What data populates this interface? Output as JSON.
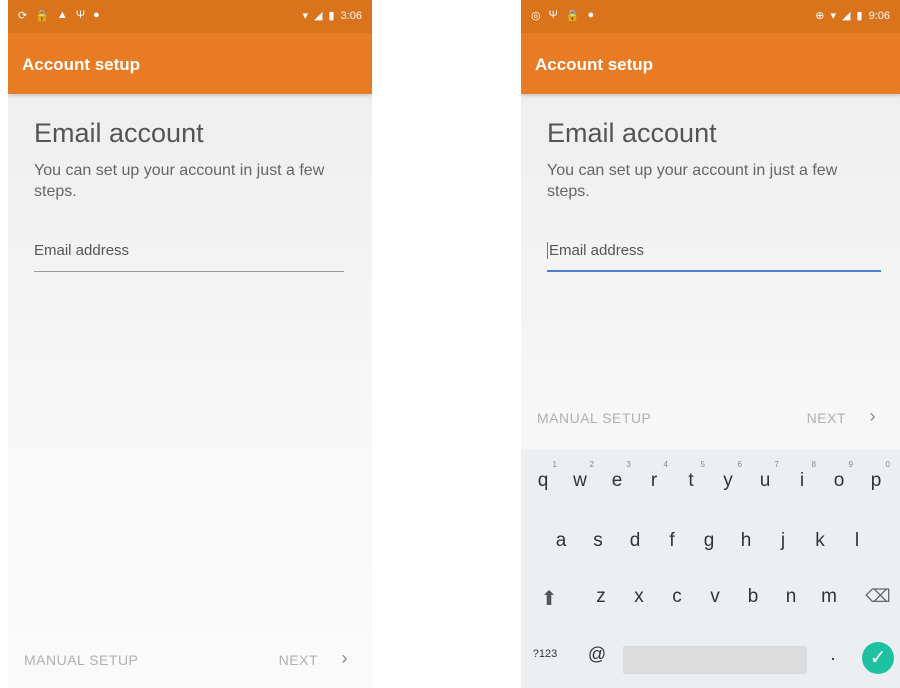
{
  "left": {
    "status": {
      "left_icons": [
        "⟳",
        "🔒",
        "▲",
        "Ψ",
        "●"
      ],
      "time": "3:06"
    },
    "app_title": "Account setup",
    "heading": "Email account",
    "subtitle": "You can set up your account in just a few steps.",
    "email_placeholder": "Email address",
    "manual_setup": "MANUAL SETUP",
    "next": "NEXT",
    "chevron": "›"
  },
  "right": {
    "status": {
      "left_icons": [
        "◎",
        "Ψ",
        "🔒",
        "●"
      ],
      "time": "9:06"
    },
    "app_title": "Account setup",
    "heading": "Email account",
    "subtitle": "You can set up your account in just a few steps.",
    "email_placeholder": "Email address",
    "manual_setup": "MANUAL SETUP",
    "next": "NEXT",
    "chevron": "›",
    "keyboard": {
      "row1": [
        "q",
        "w",
        "e",
        "r",
        "t",
        "y",
        "u",
        "i",
        "o",
        "p"
      ],
      "row1_nums": [
        "1",
        "2",
        "3",
        "4",
        "5",
        "6",
        "7",
        "8",
        "9",
        "0"
      ],
      "row2": [
        "a",
        "s",
        "d",
        "f",
        "g",
        "h",
        "j",
        "k",
        "l"
      ],
      "row3": [
        "z",
        "x",
        "c",
        "v",
        "b",
        "n",
        "m"
      ],
      "symbols_key": "?123",
      "at_key": "@",
      "period_key": ".",
      "shift_icon": "shift-arrow-icon",
      "backspace_icon": "backspace-icon",
      "enter_icon": "check-icon"
    }
  }
}
